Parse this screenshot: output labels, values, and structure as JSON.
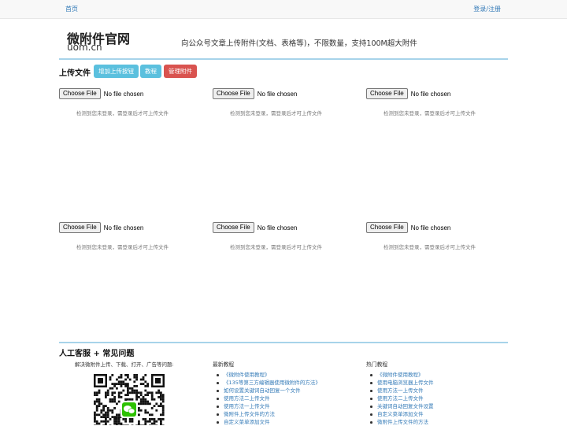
{
  "nav": {
    "home": "首页",
    "login": "登录/注册"
  },
  "site": {
    "title": "微附件官网",
    "domain": "uom.cn",
    "slogan": "向公众号文章上传附件(文档、表格等)，不限数量，支持100M超大附件"
  },
  "upload": {
    "title": "上传文件",
    "add_button": "增加上传按钮",
    "tutorial_button": "教程",
    "manage_button": "管理附件",
    "choose_label": "Choose File",
    "no_file": "No file chosen",
    "notice": "检测到您未登录，需登录后才可上传文件"
  },
  "support": {
    "title": "人工客服 + 常见问题",
    "caption": "解决微附件上传、下载、打开、广告等问题:",
    "latest_title": "最新教程",
    "latest": [
      "《微附件使用教程》",
      "《135等第三方编辑器使用微附件的方法》",
      "如何设置关键词自动回复一个文件",
      "使用方法二上传文件",
      "使用方法一上传文件",
      "微附件上传文件的方法",
      "自定义菜单添加文件"
    ],
    "hot_title": "热门教程",
    "hot": [
      "《微附件使用教程》",
      "使用电脑浏览器上传文件",
      "使用方法一上传文件",
      "使用方法二上传文件",
      "关键词自动回复文件设置",
      "自定义菜单添加文件",
      "微附件上传文件的方法"
    ]
  },
  "colors": {
    "accent_line": "#a7d3ea",
    "info": "#5bc0de",
    "danger": "#d9534f",
    "link": "#337ab7"
  }
}
